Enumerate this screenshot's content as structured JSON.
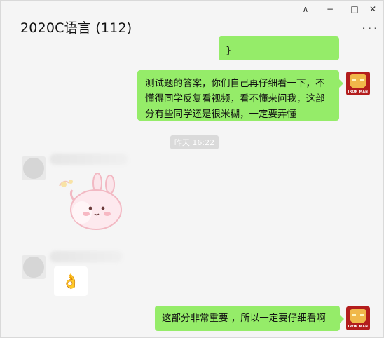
{
  "window": {
    "title": "2020C语言 (112)",
    "controls": {
      "pin": "⊼",
      "minimize": "−",
      "maximize": "□",
      "close": "✕"
    },
    "more": "···"
  },
  "messages": [
    {
      "from": "me",
      "text": "}"
    },
    {
      "from": "me",
      "text": "测试题的答案，你们自己再仔细看一下，不懂得同学反复看视频，看不懂来问我，这部分有些同学还是很米糊，一定要弄懂"
    },
    {
      "type": "time",
      "text": "昨天 16:22"
    },
    {
      "from": "other",
      "type": "sticker",
      "sticker": "bunny-sticker"
    },
    {
      "from": "other",
      "type": "emoji",
      "emoji": "👌"
    },
    {
      "from": "me",
      "text": "这部分非常重要 ，所以一定要仔细看啊"
    }
  ],
  "avatar_me": {
    "caption": "IRON MAN"
  },
  "colors": {
    "bubble_me": "#95ec69",
    "bubble_other": "#ffffff",
    "bg": "#f5f5f5"
  }
}
